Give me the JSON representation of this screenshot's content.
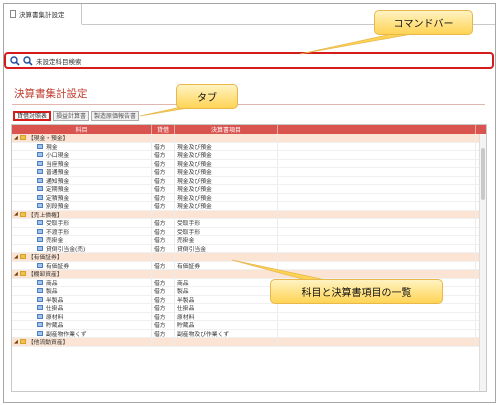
{
  "window": {
    "tab_title": "決算書集計設定"
  },
  "command_bar": {
    "search_label": "未設定科目検索"
  },
  "section_title": "決算書集計設定",
  "tabs": [
    {
      "label": "貸借対照表",
      "active": true
    },
    {
      "label": "損益計算書",
      "active": false
    },
    {
      "label": "製造原価報告書",
      "active": false
    }
  ],
  "grid": {
    "columns": [
      "科目",
      "貸借",
      "決算書項目"
    ],
    "rows": [
      {
        "type": "group",
        "label": "【現金・預金】",
        "side": "",
        "item": ""
      },
      {
        "type": "item",
        "label": "現金",
        "side": "借方",
        "item": "現金及び預金"
      },
      {
        "type": "item",
        "label": "小口現金",
        "side": "借方",
        "item": "現金及び預金"
      },
      {
        "type": "item",
        "label": "当座預金",
        "side": "借方",
        "item": "現金及び預金"
      },
      {
        "type": "item",
        "label": "普通預金",
        "side": "借方",
        "item": "現金及び預金"
      },
      {
        "type": "item",
        "label": "通知預金",
        "side": "借方",
        "item": "現金及び預金"
      },
      {
        "type": "item",
        "label": "定期預金",
        "side": "借方",
        "item": "現金及び預金"
      },
      {
        "type": "item",
        "label": "定積預金",
        "side": "借方",
        "item": "現金及び預金"
      },
      {
        "type": "item",
        "label": "別段預金",
        "side": "借方",
        "item": "現金及び預金"
      },
      {
        "type": "group",
        "label": "【売上債権】",
        "side": "",
        "item": ""
      },
      {
        "type": "item",
        "label": "受取手形",
        "side": "借方",
        "item": "受取手形"
      },
      {
        "type": "item",
        "label": "不渡手形",
        "side": "借方",
        "item": "受取手形"
      },
      {
        "type": "item",
        "label": "売掛金",
        "side": "借方",
        "item": "売掛金"
      },
      {
        "type": "item",
        "label": "貸倒引当金(売)",
        "side": "借方",
        "item": "貸倒引当金"
      },
      {
        "type": "group",
        "label": "【有価証券】",
        "side": "",
        "item": ""
      },
      {
        "type": "item",
        "label": "有価証券",
        "side": "借方",
        "item": "有価証券"
      },
      {
        "type": "group",
        "label": "【棚卸資産】",
        "side": "",
        "item": ""
      },
      {
        "type": "item",
        "label": "商品",
        "side": "借方",
        "item": "商品"
      },
      {
        "type": "item",
        "label": "製品",
        "side": "借方",
        "item": "製品"
      },
      {
        "type": "item",
        "label": "半製品",
        "side": "借方",
        "item": "半製品"
      },
      {
        "type": "item",
        "label": "仕掛品",
        "side": "借方",
        "item": "仕掛品"
      },
      {
        "type": "item",
        "label": "原材料",
        "side": "借方",
        "item": "原材料"
      },
      {
        "type": "item",
        "label": "貯蔵品",
        "side": "借方",
        "item": "貯蔵品"
      },
      {
        "type": "item",
        "label": "副産物作業くず",
        "side": "借方",
        "item": "副産物及び作業くず"
      },
      {
        "type": "group",
        "label": "【他流動資産】",
        "side": "",
        "item": ""
      }
    ]
  },
  "callouts": {
    "command_bar": "コマンドバー",
    "tabs": "タブ",
    "list": "科目と決算書項目の一覧"
  },
  "colors": {
    "accent_red": "#d61b1b",
    "header_red": "#d9534f",
    "group_row": "#fbe4d3",
    "callout_yellow": "#ffd455"
  }
}
